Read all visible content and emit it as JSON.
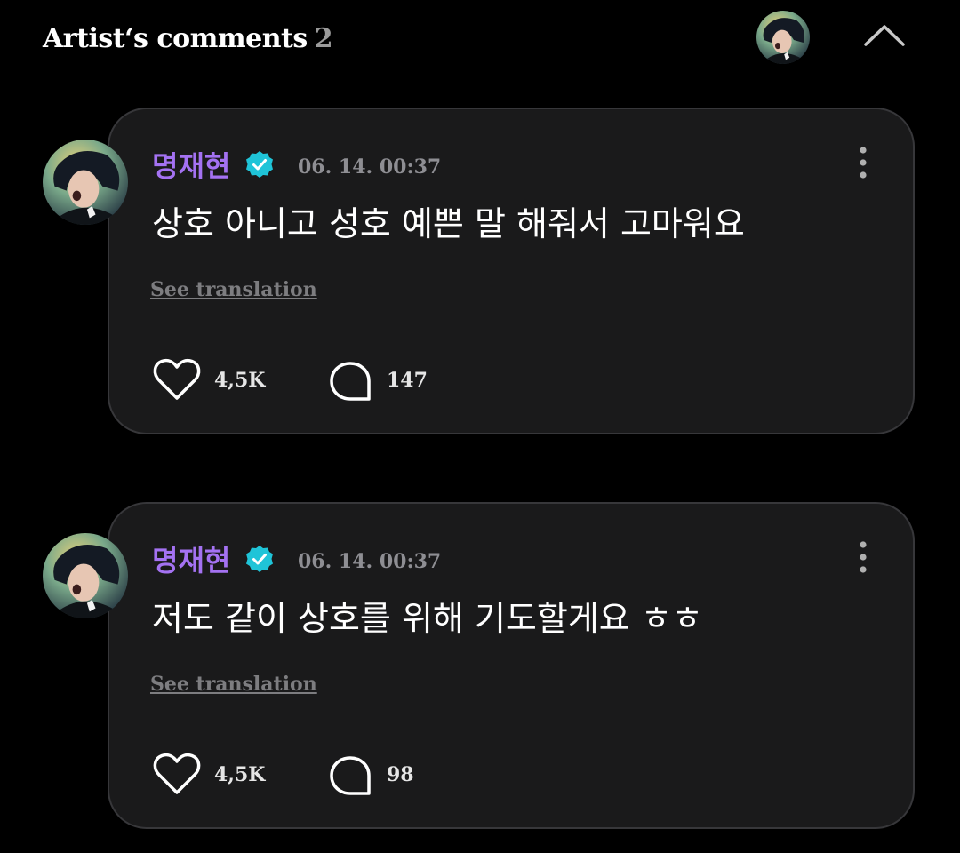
{
  "header": {
    "title": "Artist‘s comments",
    "count": "2",
    "avatar_icon": "profile-avatar",
    "collapse_icon": "chevron-up-icon"
  },
  "colors": {
    "background": "#000000",
    "card": "#1a1a1b",
    "card_border": "#37373a",
    "author": "#a472f2",
    "verified": "#1fc4d8",
    "muted": "#8e8e93"
  },
  "comments": [
    {
      "author": "명재현",
      "verified_icon": "verified-badge-icon",
      "timestamp": "06. 14. 00:37",
      "text": "상호 아니고 성호 예쁜 말 해줘서 고마워요",
      "translation_label": "See translation",
      "likes": "4,5K",
      "replies": "147"
    },
    {
      "author": "명재현",
      "verified_icon": "verified-badge-icon",
      "timestamp": "06. 14. 00:37",
      "text": "저도 같이 상호를 위해 기도할게요 ㅎㅎ",
      "translation_label": "See translation",
      "likes": "4,5K",
      "replies": "98"
    }
  ]
}
